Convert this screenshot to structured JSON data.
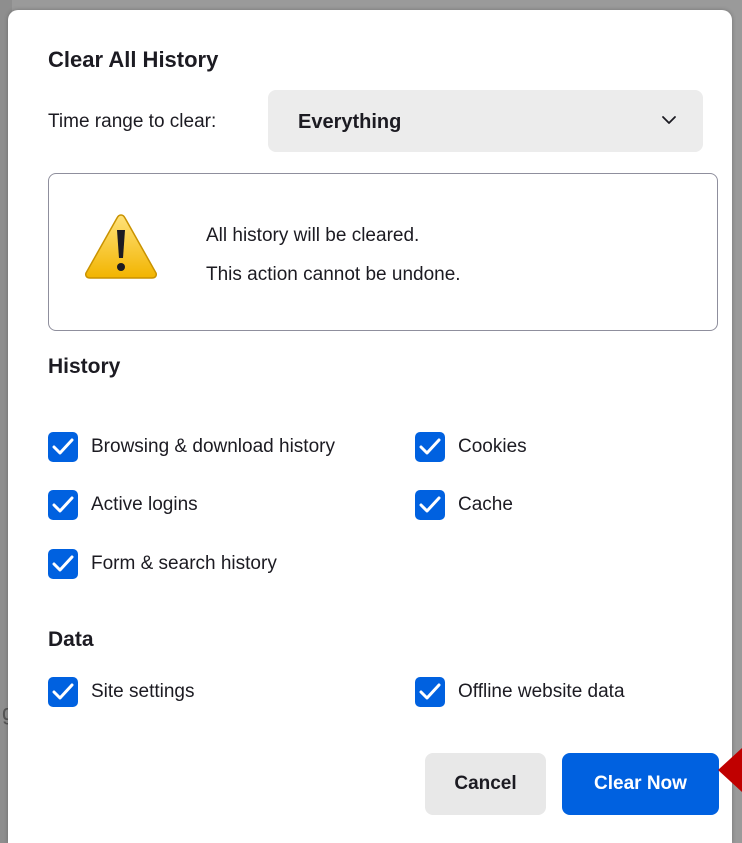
{
  "dialog": {
    "title": "Clear All History",
    "time_range": {
      "label": "Time range to clear:",
      "selected": "Everything"
    },
    "warning": {
      "line1": "All history will be cleared.",
      "line2": "This action cannot be undone."
    },
    "history_section": {
      "heading": "History",
      "items": [
        {
          "label": "Browsing & download history",
          "checked": true
        },
        {
          "label": "Cookies",
          "checked": true
        },
        {
          "label": "Active logins",
          "checked": true
        },
        {
          "label": "Cache",
          "checked": true
        },
        {
          "label": "Form & search history",
          "checked": true
        }
      ]
    },
    "data_section": {
      "heading": "Data",
      "items": [
        {
          "label": "Site settings",
          "checked": true
        },
        {
          "label": "Offline website data",
          "checked": true
        }
      ]
    },
    "buttons": {
      "cancel": "Cancel",
      "clear_now": "Clear Now"
    }
  },
  "colors": {
    "accent": "#0061e0",
    "warning_icon": "#f5c400",
    "pointer": "#c00000"
  },
  "icons": {
    "warning": "warning-triangle-icon",
    "checkbox": "checkmark-icon",
    "dropdown": "chevron-down-icon",
    "pointer": "pointer-arrow-icon"
  }
}
